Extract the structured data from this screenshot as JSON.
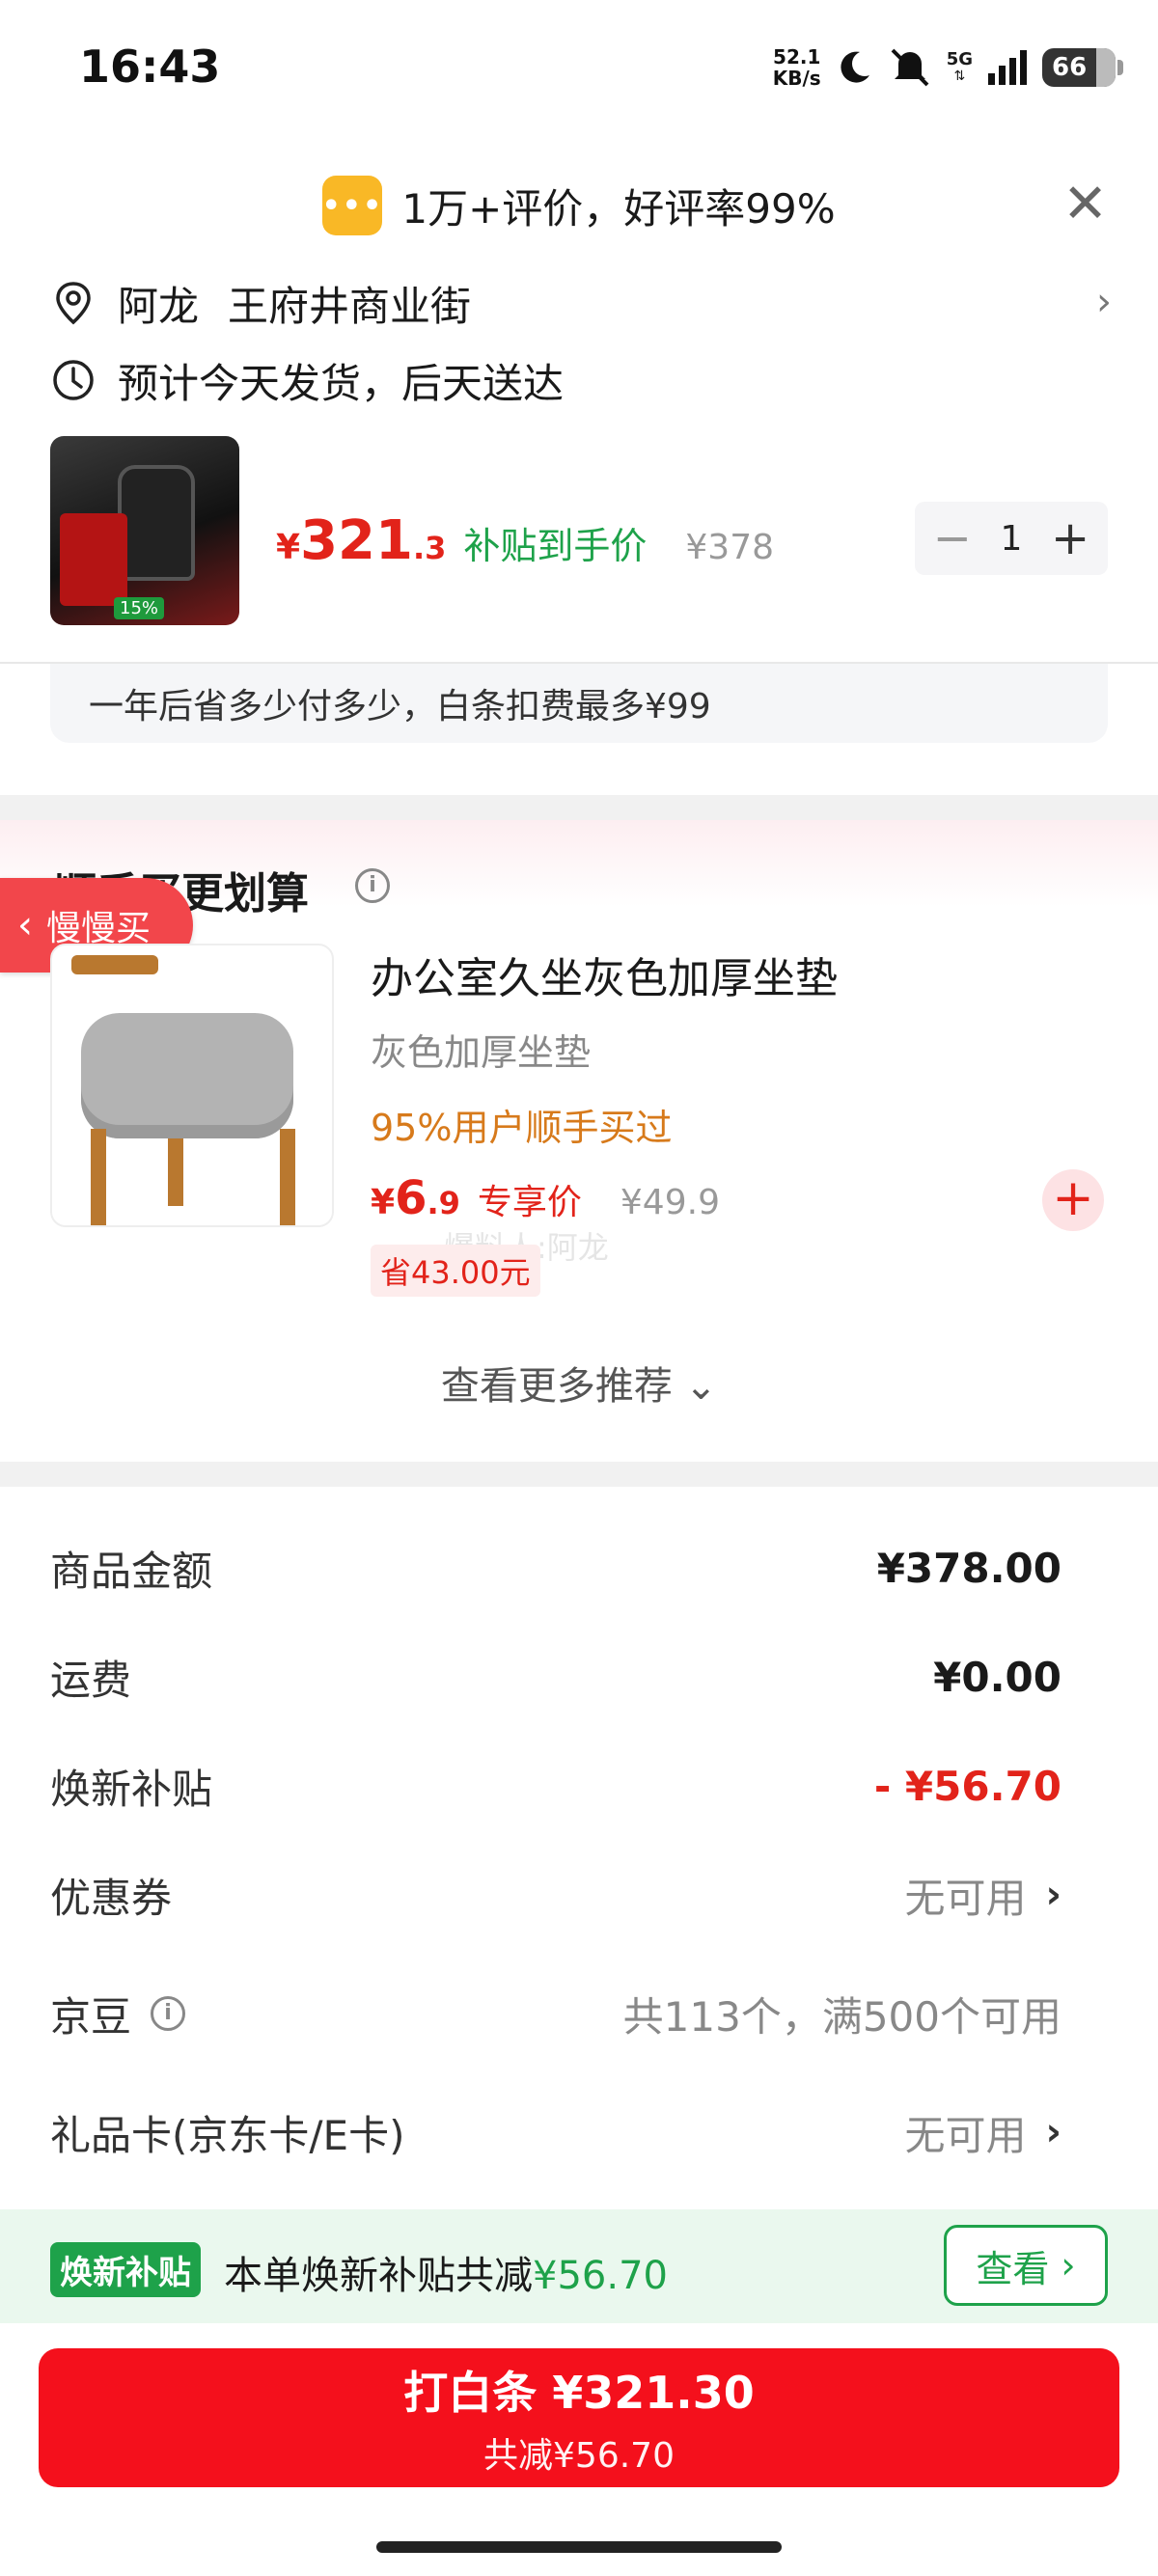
{
  "status": {
    "time": "16:43",
    "net_speed_value": "52.1",
    "net_speed_unit": "KB/s",
    "signal": "5G",
    "battery": "66"
  },
  "review_banner": {
    "icon_text": "•••",
    "text": "1万+评价，好评率99%"
  },
  "address": {
    "name": "阿龙",
    "detail": "王府井商业街"
  },
  "shipping": {
    "text": "预计今天发货，后天送达"
  },
  "product": {
    "price_symbol": "¥",
    "price_int": "321",
    "price_dec": ".3",
    "price_label": "补贴到手价",
    "original_price": "¥378",
    "image_badge": "15%",
    "quantity": "1",
    "minus": "−",
    "plus": "+"
  },
  "baitiao_note": "一年后省多少付多少，白条扣费最多¥99",
  "recommend": {
    "title": "顺手买更划算",
    "back_button": "慢慢买",
    "item": {
      "name": "办公室久坐灰色加厚坐垫",
      "spec": "灰色加厚坐垫",
      "hint": "95%用户顺手买过",
      "price_symbol": "¥",
      "price_int": "6",
      "price_dec": ".9",
      "price_label": "专享价",
      "original_price": "¥49.9",
      "save": "省43.00元",
      "add": "+"
    },
    "more": "查看更多推荐 ⌄",
    "watermark": "爆料人:阿龙"
  },
  "costs": [
    {
      "label": "商品金额",
      "value": "¥378.00",
      "style": "normal"
    },
    {
      "label": "运费",
      "value": "¥0.00",
      "style": "normal"
    },
    {
      "label": "焕新补贴",
      "value": "- ¥56.70",
      "style": "red"
    },
    {
      "label": "优惠券",
      "value": "无可用",
      "style": "grey",
      "chevron": "›"
    },
    {
      "label": "京豆",
      "value": "共113个，满500个可用",
      "style": "grey"
    },
    {
      "label": "礼品卡(京东卡/E卡)",
      "value": "无可用",
      "style": "grey",
      "chevron": "›"
    }
  ],
  "subsidy": {
    "tag": "焕新补贴",
    "text_prefix": "本单焕新补贴共减",
    "amount": "¥56.70",
    "view_button": "查看",
    "view_chevron": "›"
  },
  "pay": {
    "main": "打白条 ¥321.30",
    "sub": "共减¥56.70"
  },
  "colors": {
    "accent_red": "#e2231a",
    "pay_red": "#f4101c",
    "subsidy_green": "#1ea24a",
    "hint_orange": "#d77a1b"
  }
}
